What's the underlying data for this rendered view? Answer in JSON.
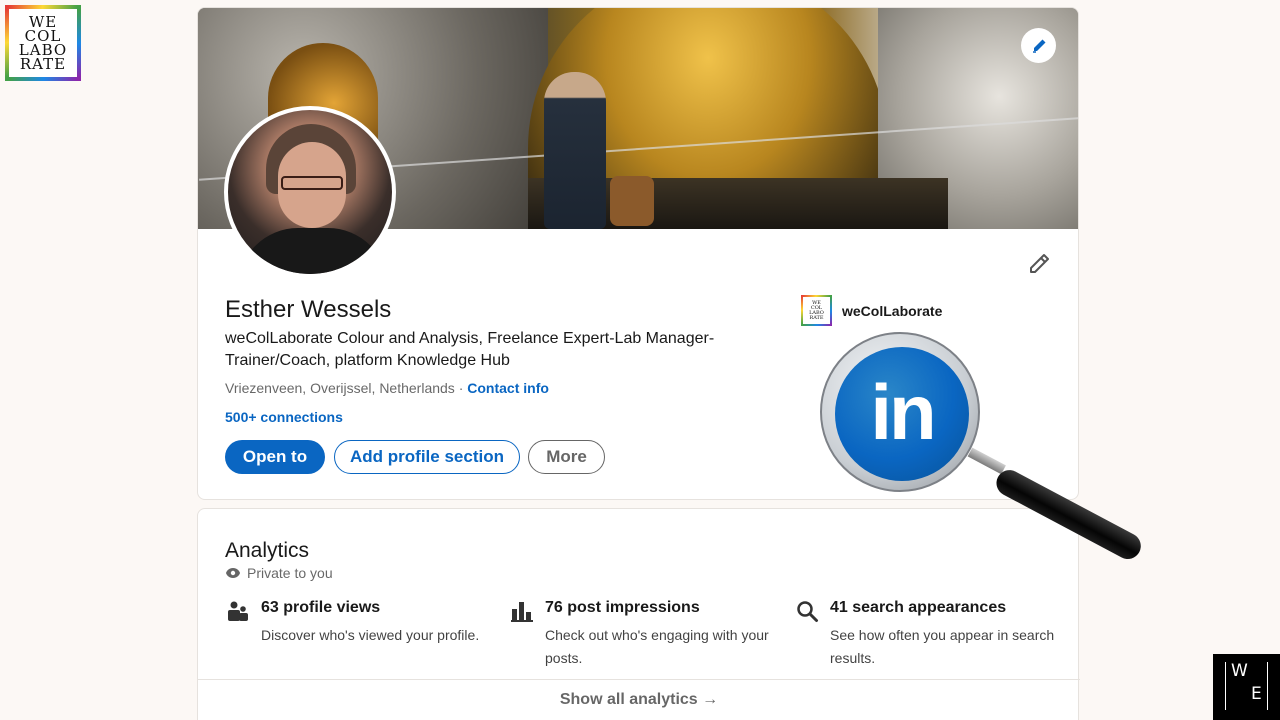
{
  "brand_logo": {
    "lines": [
      "WE",
      "COL",
      "LABO",
      "RATE"
    ]
  },
  "we_logo": {
    "w": "W",
    "e": "E"
  },
  "profile": {
    "name": "Esther Wessels",
    "headline": "weColLaborate Colour and Analysis, Freelance Expert-Lab Manager-Trainer/Coach, platform Knowledge Hub",
    "location": "Vriezenveen, Overijssel, Netherlands",
    "separator": "·",
    "contact_info": "Contact info",
    "connections": "500+ connections",
    "buttons": {
      "open_to": "Open to",
      "add_section": "Add profile section",
      "more": "More"
    },
    "company": {
      "name": "weColLaborate",
      "logo_lines": [
        "WE",
        "COL",
        "LABO",
        "RATE"
      ]
    }
  },
  "magnifier": {
    "badge_text": "in"
  },
  "analytics": {
    "title": "Analytics",
    "privacy": "Private to you",
    "metrics": [
      {
        "icon": "people-icon",
        "title": "63 profile views",
        "desc": "Discover who's viewed your profile."
      },
      {
        "icon": "bar-chart-icon",
        "title": "76 post impressions",
        "desc": "Check out who's engaging with your posts."
      },
      {
        "icon": "search-icon",
        "title": "41 search appearances",
        "desc": "See how often you appear in search results."
      }
    ],
    "show_all": "Show all analytics →"
  },
  "colors": {
    "linkedin_blue": "#0a66c2",
    "page_bg": "#fcf8f5"
  }
}
